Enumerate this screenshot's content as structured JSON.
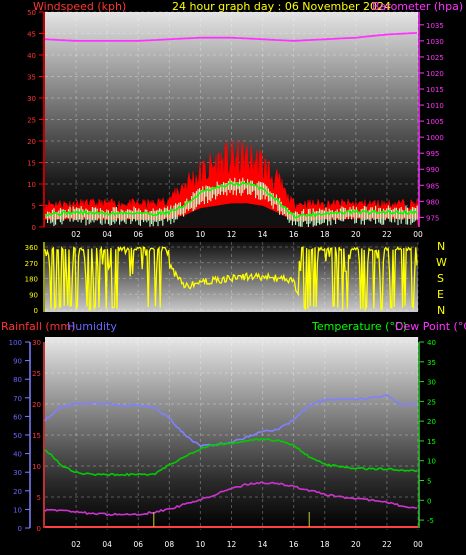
{
  "colors": {
    "background": "#000000",
    "wind": "#ff0000",
    "wind_avg": "#00ff00",
    "wind_light": "#ccffcc",
    "barometer": "#ff33ff",
    "direction": "#ffff00",
    "rainfall": "#ff4040",
    "humidity": "#8080ff",
    "temperature": "#00cc00",
    "dewpoint": "#cc33cc",
    "label_red": "#ff3333",
    "label_yellow": "#ffff00",
    "label_magenta": "#ff33ff",
    "label_blue": "#6666ff",
    "label_green": "#00ff00",
    "axis_green": "#33cc33",
    "tick_white": "#ffffff"
  },
  "header": {
    "wind_label": "Windspeed (kph)",
    "title": "24 hour graph day : 06 November 2024",
    "baro_label": "Barometer (hpa)"
  },
  "compass": [
    "N",
    "W",
    "S",
    "E",
    "N"
  ],
  "legend2": {
    "rain": "Rainfall (mm)",
    "humidity": "Humidity",
    "temperature": "Temperature (°C)",
    "dewpoint": "Dew Point (°C)"
  },
  "chart_data": [
    {
      "type": "line",
      "title": "24 hour graph day : 06 November 2024",
      "x_ticks": [
        "02",
        "04",
        "06",
        "08",
        "10",
        "12",
        "14",
        "16",
        "18",
        "20",
        "22",
        "00"
      ],
      "left_axis": {
        "label": "Windspeed (kph)",
        "range": [
          0,
          50
        ],
        "ticks": [
          0,
          5,
          10,
          15,
          20,
          25,
          30,
          35,
          40,
          45,
          50
        ]
      },
      "right_axis": {
        "label": "Barometer (hpa)",
        "range": [
          972,
          1039
        ],
        "ticks": [
          975,
          980,
          985,
          990,
          995,
          1000,
          1005,
          1010,
          1015,
          1020,
          1025,
          1030,
          1035
        ]
      },
      "series": [
        {
          "name": "Barometer (hpa)",
          "axis": "right",
          "x": [
            0,
            2,
            4,
            6,
            8,
            10,
            12,
            14,
            16,
            18,
            20,
            22,
            24
          ],
          "values": [
            1030.5,
            1030.0,
            1030.0,
            1030.0,
            1030.5,
            1031.0,
            1031.0,
            1030.5,
            1030.0,
            1030.5,
            1031.0,
            1032.0,
            1032.5
          ]
        },
        {
          "axis": "left",
          "x": [
            0,
            1,
            2,
            3,
            4,
            5,
            6,
            7,
            8,
            9,
            10,
            11,
            12,
            13,
            14,
            15,
            16,
            17,
            18,
            19,
            20,
            21,
            22,
            23,
            24
          ],
          "values": [
            5,
            5,
            5,
            5,
            5,
            5,
            5,
            5,
            6,
            9,
            11,
            13,
            14,
            14,
            13,
            9,
            5,
            5,
            5,
            5,
            5,
            5,
            5,
            5,
            5
          ]
        },
        {
          "axis": "left",
          "x": [
            0,
            1,
            2,
            3,
            4,
            5,
            6,
            7,
            8,
            9,
            10,
            11,
            12,
            13,
            14,
            15,
            16,
            17,
            18,
            19,
            20,
            21,
            22,
            23,
            24
          ],
          "values": [
            3,
            3.2,
            3.4,
            3.3,
            3.1,
            3.2,
            3.3,
            3,
            3.5,
            5,
            8,
            9,
            10,
            10,
            9,
            6,
            2.5,
            2.8,
            3.2,
            3.3,
            3.5,
            3.4,
            3.5,
            3.4,
            3.5
          ]
        }
      ]
    },
    {
      "type": "line",
      "x_ticks": [
        "02",
        "04",
        "06",
        "08",
        "10",
        "12",
        "14",
        "16",
        "18",
        "20",
        "22",
        "00"
      ],
      "left_axis": {
        "range": [
          0,
          360
        ],
        "ticks": [
          0,
          90,
          180,
          270,
          360
        ]
      },
      "series": [
        {
          "axis": "left",
          "x": [
            0,
            1,
            2,
            3,
            4,
            5,
            6,
            7,
            7.5,
            8,
            9,
            10,
            11,
            12,
            13,
            14,
            15,
            16,
            16.5,
            17,
            18,
            19,
            20,
            21,
            22,
            23,
            24
          ],
          "values": [
            340,
            10,
            350,
            20,
            340,
            10,
            330,
            350,
            340,
            250,
            130,
            160,
            170,
            180,
            190,
            190,
            180,
            170,
            10,
            330,
            20,
            340,
            10,
            350,
            20,
            340,
            10
          ]
        }
      ]
    },
    {
      "type": "line",
      "x_ticks": [
        "02",
        "04",
        "06",
        "08",
        "10",
        "12",
        "14",
        "16",
        "18",
        "20",
        "22",
        "00"
      ],
      "humidity_axis": {
        "label": "Humidity",
        "range": [
          0,
          100
        ],
        "ticks": [
          0,
          10,
          20,
          30,
          40,
          50,
          60,
          70,
          80,
          90,
          100
        ]
      },
      "rain_axis": {
        "label": "Rainfall (mm)",
        "range": [
          0,
          30
        ],
        "ticks": [
          0,
          5,
          10,
          15,
          20,
          25,
          30
        ]
      },
      "temp_axis": {
        "label": "Temperature (°C)",
        "range": [
          -7,
          40
        ],
        "ticks": [
          -5,
          0,
          5,
          10,
          15,
          20,
          25,
          30,
          35,
          40
        ]
      },
      "series": [
        {
          "name": "Humidity",
          "axis": "humidity",
          "x": [
            0,
            1,
            2,
            3,
            4,
            5,
            6,
            7,
            8,
            9,
            10,
            11,
            12,
            13,
            14,
            15,
            16,
            17,
            18,
            19,
            20,
            21,
            22,
            23,
            24
          ],
          "values": [
            58,
            65,
            67,
            67,
            67,
            66,
            66,
            65,
            59,
            50,
            44,
            45,
            46,
            49,
            52,
            53,
            58,
            66,
            69,
            69,
            69,
            70,
            71,
            66,
            67
          ]
        },
        {
          "name": "Temperature (°C)",
          "axis": "temp",
          "x": [
            0,
            1,
            2,
            3,
            4,
            5,
            6,
            7,
            8,
            9,
            10,
            11,
            12,
            13,
            14,
            15,
            16,
            17,
            18,
            19,
            20,
            21,
            22,
            23,
            24
          ],
          "values": [
            13,
            9,
            7,
            6.5,
            6.5,
            6.5,
            6.5,
            6.5,
            9,
            11,
            13,
            14,
            14.5,
            15,
            15.5,
            15,
            14,
            11,
            9,
            8.5,
            8,
            8,
            8,
            7.5,
            7.5
          ]
        },
        {
          "name": "Dew Point (°C)",
          "axis": "temp",
          "x": [
            0,
            1,
            2,
            3,
            4,
            5,
            6,
            7,
            8,
            9,
            10,
            11,
            12,
            13,
            14,
            15,
            16,
            17,
            18,
            19,
            20,
            21,
            22,
            23,
            24
          ],
          "values": [
            -2.5,
            -2.5,
            -3,
            -3.3,
            -3.6,
            -3.6,
            -3.6,
            -3,
            -2.2,
            -1,
            0.3,
            1.5,
            3,
            4,
            4.5,
            4.2,
            3.5,
            2.5,
            1.5,
            0.8,
            0.5,
            0,
            -0.5,
            -1.5,
            -2
          ]
        },
        {
          "name": "Rainfall (mm)",
          "axis": "rain",
          "x": [
            0,
            24
          ],
          "values": [
            0,
            0
          ]
        }
      ]
    }
  ]
}
